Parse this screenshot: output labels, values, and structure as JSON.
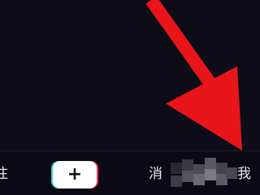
{
  "tabbar": {
    "tab_first_label": "往",
    "create_icon": "+",
    "tab_messages_label": "消",
    "tab_me_label": "我"
  },
  "annotation": {
    "arrow_color": "#e8151b",
    "arrow_icon": "red-arrow-pointing-down-right"
  },
  "colors": {
    "background": "#0d0c17",
    "create_left_edge": "#2bd6dc",
    "create_right_edge": "#f0365f"
  }
}
